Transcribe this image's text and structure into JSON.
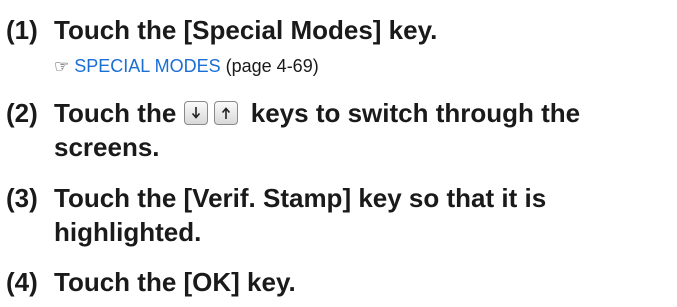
{
  "steps": [
    {
      "number": "(1)",
      "lines": [
        "Touch the [Special Modes] key."
      ],
      "reference": {
        "hand_icon": "pointing-hand-icon",
        "link_text": "SPECIAL MODES",
        "page_text": "(page 4-69)"
      }
    },
    {
      "number": "(2)",
      "line1_before": "Touch the",
      "line1_after": "keys to switch through the",
      "line2": "screens.",
      "key_icons": [
        "arrow-down-key-icon",
        "arrow-up-key-icon"
      ]
    },
    {
      "number": "(3)",
      "lines": [
        "Touch the [Verif. Stamp] key so that it is",
        "highlighted."
      ]
    },
    {
      "number": "(4)",
      "lines": [
        "Touch the [OK] key."
      ]
    }
  ]
}
